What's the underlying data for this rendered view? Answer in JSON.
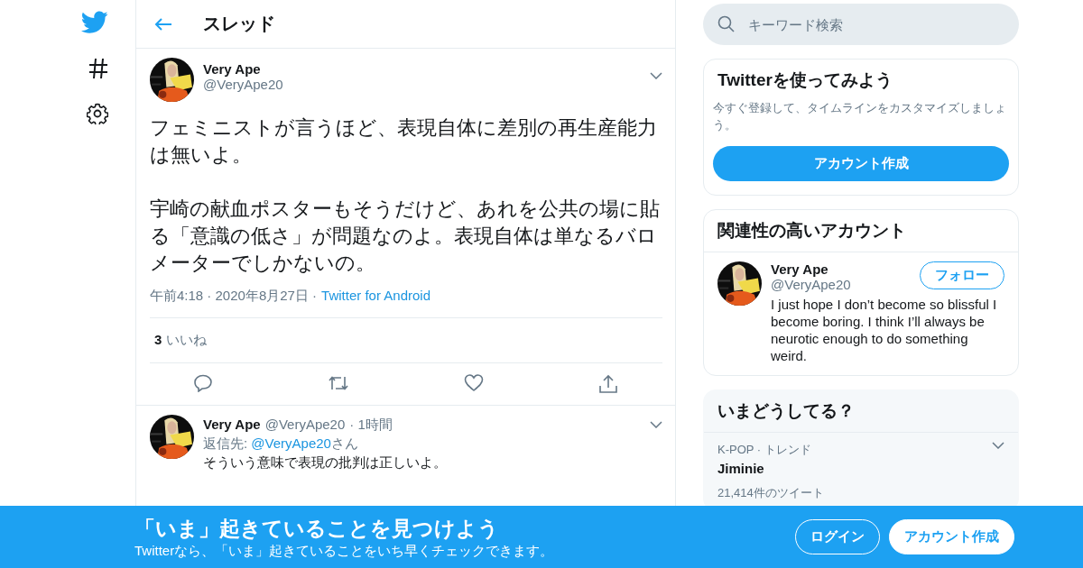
{
  "header": {
    "title": "スレッド"
  },
  "main_tweet": {
    "name": "Very Ape",
    "handle": "@VeryApe20",
    "paragraphs": [
      "フェミニストが言うほど、表現自体に差別の再生産能力は無いよ。",
      "宇崎の献血ポスターもそうだけど、あれを公共の場に貼る「意識の低さ」が問題なのよ。表現自体は単なるバロメーターでしかないの。"
    ],
    "timestamp": "午前4:18 · 2020年8月27日 ·",
    "source": "Twitter for Android",
    "likes": "**3** いいね"
  },
  "reply": {
    "name": "Very Ape",
    "handle": "@VeryApe20",
    "time": "· 1時間",
    "reply_to_label": "返信先: ",
    "reply_to_handle": "@VeryApe20",
    "reply_to_suffix": "さん",
    "text": "そういう意味で表現の批判は正しいよ。"
  },
  "search": {
    "placeholder": "キーワード検索"
  },
  "signup_card": {
    "title": "Twitterを使ってみよう",
    "text": "今すぐ登録して、タイムラインをカスタマイズしましょう。",
    "button": "アカウント作成"
  },
  "related": {
    "title": "関連性の高いアカウント",
    "accounts": [
      {
        "name": "Very Ape",
        "handle": "@VeryApe20",
        "button": "フォロー",
        "bio": "I just hope I don’t become so blissful I become boring. I think I’ll always be neurotic enough to do something weird."
      }
    ]
  },
  "trends": {
    "title": "いまどうしてる？",
    "items": [
      {
        "meta": "K-POP · トレンド",
        "name": "Jiminie",
        "count": "21,414件のツイート"
      }
    ]
  },
  "banner": {
    "title": "「いま」起きていることを見つけよう",
    "subtitle": "Twitterなら、「いま」起きていることをいち早くチェックできます。",
    "buttons": [
      {
        "label": "ログイン",
        "kind": "outline"
      },
      {
        "label": "アカウント作成",
        "kind": "filled"
      }
    ]
  }
}
